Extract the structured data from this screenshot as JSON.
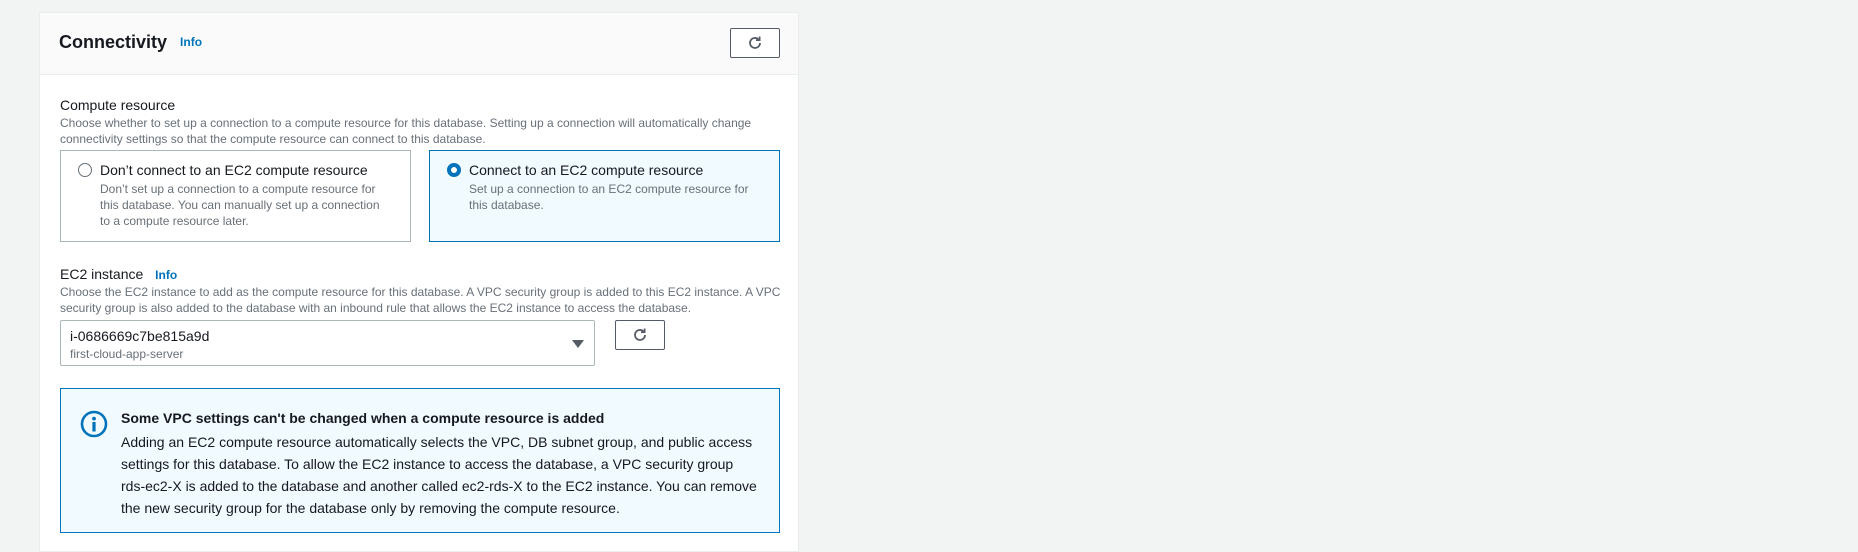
{
  "connectivity": {
    "title": "Connectivity",
    "info_label": "Info",
    "refresh_icon": "refresh-icon"
  },
  "compute_resource": {
    "label": "Compute resource",
    "description": "Choose whether to set up a connection to a compute resource for this database. Setting up a connection will automatically change connectivity settings so that the compute resource can connect to this database.",
    "options": [
      {
        "title": "Don’t connect to an EC2 compute resource",
        "description": "Don’t set up a connection to a compute resource for this database. You can manually set up a connection to a compute resource later.",
        "selected": false
      },
      {
        "title": "Connect to an EC2 compute resource",
        "description": "Set up a connection to an EC2 compute resource for this database.",
        "selected": true
      }
    ]
  },
  "ec2_instance": {
    "label": "EC2 instance",
    "info_label": "Info",
    "description": "Choose the EC2 instance to add as the compute resource for this database. A VPC security group is added to this EC2 instance. A VPC security group is also added to the database with an inbound rule that allows the EC2 instance to access the database.",
    "selected_value": "i-0686669c7be815a9d",
    "selected_name": "first-cloud-app-server"
  },
  "alert": {
    "icon": "info-circle-icon",
    "title": "Some VPC settings can't be changed when a compute resource is added",
    "body": "Adding an EC2 compute resource automatically selects the VPC, DB subnet group, and public access settings for this database. To allow the EC2 instance to access the database, a VPC security group rds-ec2-X is added to the database and another called ec2-rds-X to the EC2 instance. You can remove the new security group for the database only by removing the compute resource."
  },
  "colors": {
    "accent": "#0073bb",
    "page_background": "#f2f3f3",
    "selected_tile_background": "#f1faff"
  }
}
